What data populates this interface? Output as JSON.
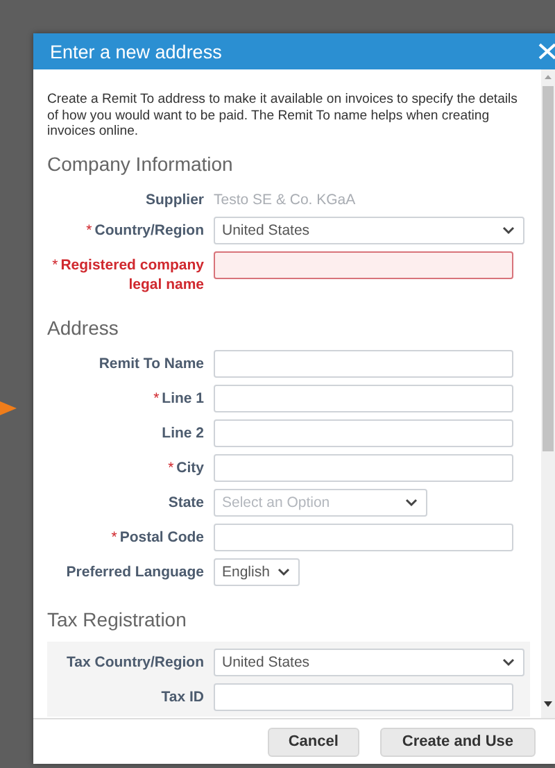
{
  "dialog": {
    "title": "Enter a new address",
    "intro": "Create a Remit To address to make it available on invoices to specify the details of how you would want to be paid. The Remit To name helps when creating invoices online.",
    "required_mark": "*",
    "sections": [
      {
        "heading": "Company Information",
        "shaded": false,
        "fields": [
          {
            "kind": "static",
            "label": "Supplier",
            "value": "Testo SE & Co. KGaA",
            "required": false,
            "error": false
          },
          {
            "kind": "dropdown",
            "label": "Country/Region",
            "value": "United States",
            "required": true,
            "error": false
          },
          {
            "kind": "text",
            "label": "Registered company legal name",
            "required": true,
            "error": true
          }
        ]
      },
      {
        "heading": "Address",
        "shaded": false,
        "fields": [
          {
            "kind": "text",
            "label": "Remit To Name",
            "required": false,
            "error": false
          },
          {
            "kind": "text",
            "label": "Line 1",
            "required": true,
            "error": false
          },
          {
            "kind": "text",
            "label": "Line 2",
            "required": false,
            "error": false
          },
          {
            "kind": "text",
            "label": "City",
            "required": true,
            "error": false
          },
          {
            "kind": "short-dropdown",
            "label": "State",
            "placeholder": "Select an Option",
            "required": false,
            "error": false
          },
          {
            "kind": "text",
            "label": "Postal Code",
            "required": true,
            "error": false
          },
          {
            "kind": "compact-dropdown",
            "label": "Preferred Language",
            "value": "English",
            "required": false,
            "error": false
          }
        ]
      },
      {
        "heading": "Tax Registration",
        "shaded": true,
        "fields": [
          {
            "kind": "dropdown",
            "label": "Tax Country/Region",
            "value": "United States",
            "required": false,
            "error": false
          },
          {
            "kind": "text",
            "label": "Tax ID",
            "required": false,
            "error": false
          }
        ]
      }
    ],
    "buttons": [
      {
        "label": "Cancel",
        "kind": "secondary"
      },
      {
        "label": "Create and Use",
        "kind": "primary"
      }
    ]
  }
}
